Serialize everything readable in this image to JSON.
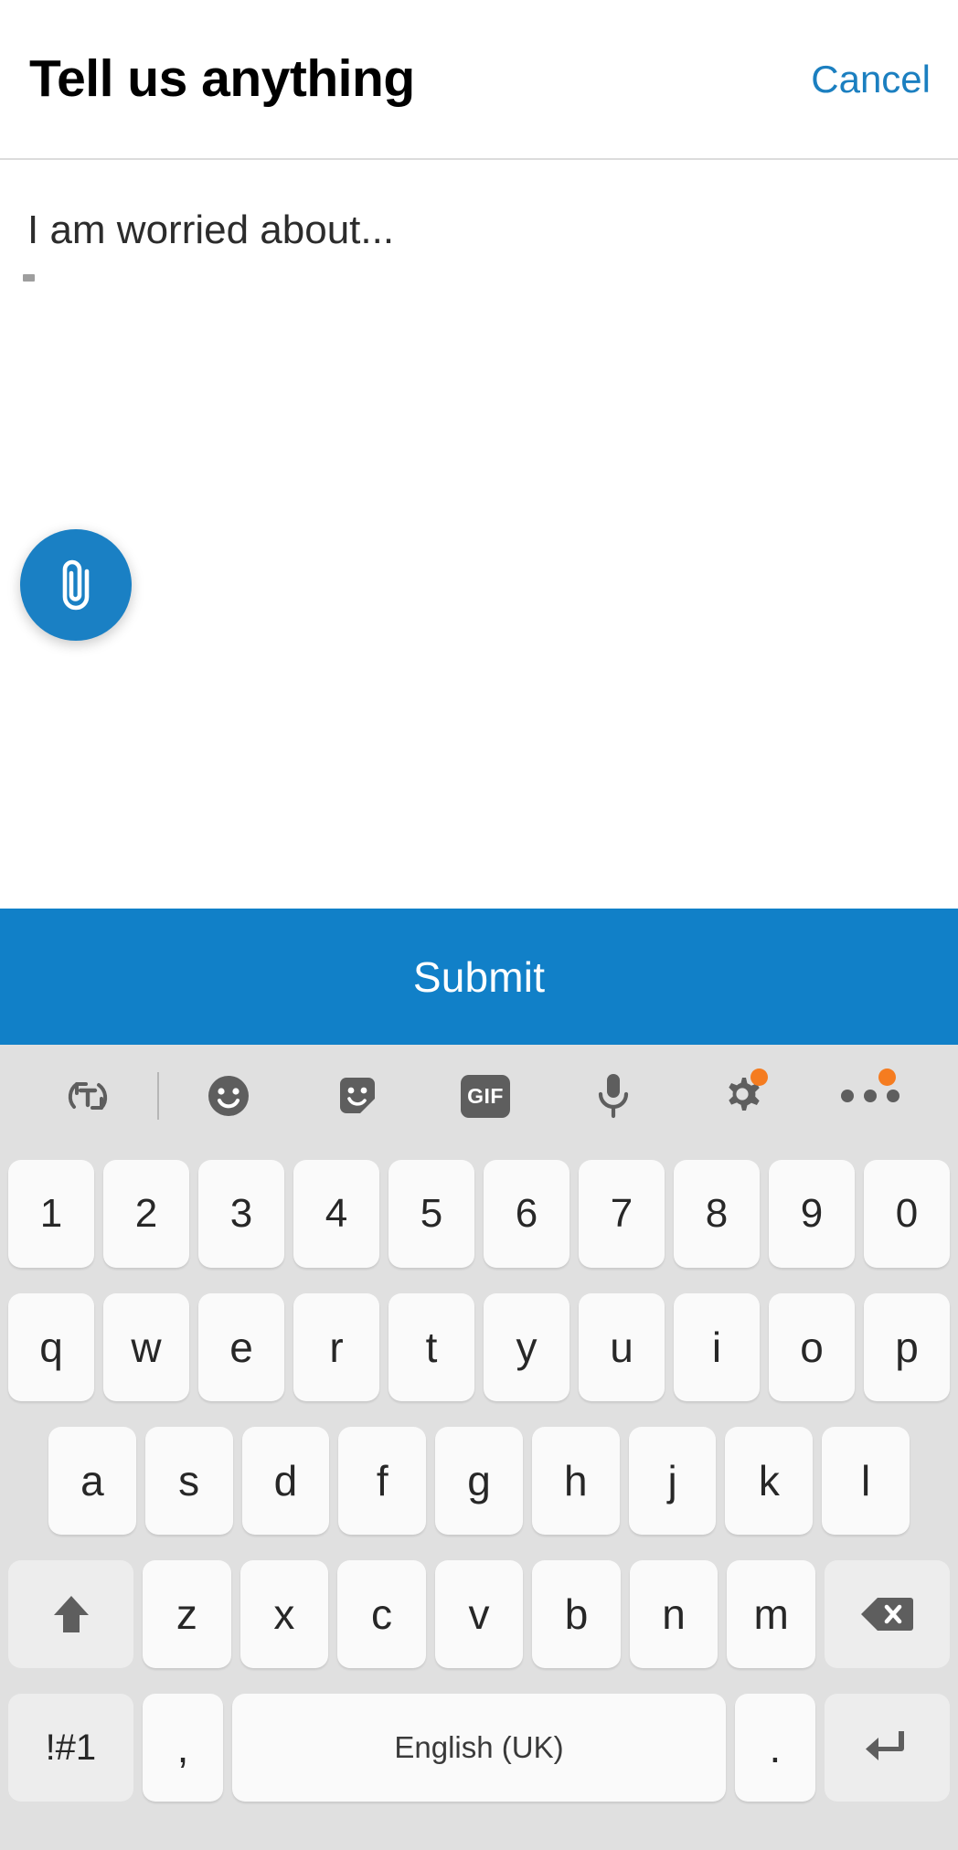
{
  "header": {
    "title": "Tell us anything",
    "cancel_label": "Cancel",
    "cancel_color": "#1b7fc0"
  },
  "compose": {
    "placeholder": "I am worried about...",
    "value": "",
    "attach_button": {
      "icon": "paperclip-icon",
      "background_color": "#1a80c4"
    }
  },
  "submit": {
    "label": "Submit",
    "background_color": "#1180c8",
    "text_color": "#ffffff"
  },
  "keyboard": {
    "background_color": "#e0e0e0",
    "key_color": "#fafafa",
    "badge_color": "#f57c20",
    "toolbar": [
      {
        "name": "translate-icon",
        "label": "",
        "badge": false
      },
      {
        "name": "divider",
        "label": "",
        "badge": false
      },
      {
        "name": "emoji-icon",
        "label": "",
        "badge": false
      },
      {
        "name": "sticker-icon",
        "label": "",
        "badge": false
      },
      {
        "name": "gif-icon",
        "label": "GIF",
        "badge": false
      },
      {
        "name": "microphone-icon",
        "label": "",
        "badge": false
      },
      {
        "name": "gear-icon",
        "label": "",
        "badge": true
      },
      {
        "name": "overflow-icon",
        "label": "",
        "badge": true
      }
    ],
    "rows": {
      "numbers": [
        "1",
        "2",
        "3",
        "4",
        "5",
        "6",
        "7",
        "8",
        "9",
        "0"
      ],
      "top": [
        "q",
        "w",
        "e",
        "r",
        "t",
        "y",
        "u",
        "i",
        "o",
        "p"
      ],
      "home": [
        "a",
        "s",
        "d",
        "f",
        "g",
        "h",
        "j",
        "k",
        "l"
      ],
      "bottom": [
        "z",
        "x",
        "c",
        "v",
        "b",
        "n",
        "m"
      ]
    },
    "shift_key": {
      "name": "shift-key",
      "label": ""
    },
    "backspace_key": {
      "name": "backspace-key",
      "label": ""
    },
    "symbols_key": {
      "label": "!#1"
    },
    "comma_key": {
      "label": ","
    },
    "space_key": {
      "label": "English (UK)"
    },
    "period_key": {
      "label": "."
    },
    "enter_key": {
      "name": "enter-key",
      "label": ""
    }
  }
}
